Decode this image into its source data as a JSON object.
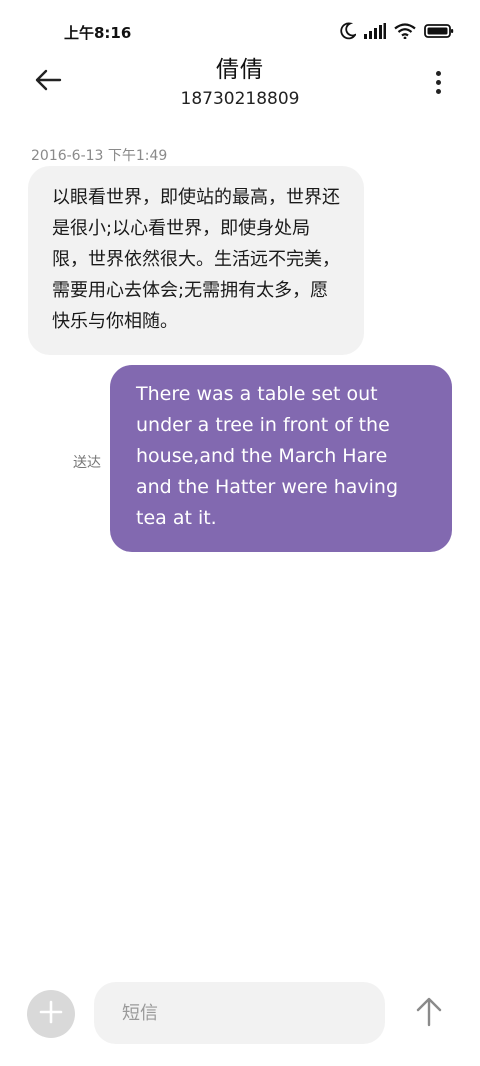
{
  "status_bar": {
    "time": "上午8:16",
    "icons": [
      "moon-icon",
      "signal-icon",
      "wifi-icon",
      "battery-icon"
    ]
  },
  "header": {
    "contact_name": "倩倩",
    "contact_number": "18730218809",
    "back_icon": "arrow-left-icon",
    "more_icon": "more-vertical-icon"
  },
  "conversation": {
    "timestamp": "2016-6-13 下午1:49",
    "incoming_message": "以眼看世界，即使站的最高，世界还是很小;以心看世界，即使身处局限，世界依然很大。生活远不完美，需要用心去体会;无需拥有太多，愿快乐与你相随。",
    "outgoing_message": "There was a table set out under a tree in front of the house,and the March Hare and the Hatter were having tea at it.",
    "outgoing_status": "送达"
  },
  "composer": {
    "placeholder": "短信",
    "value": "",
    "add_icon": "plus-icon",
    "send_icon": "arrow-up-icon"
  },
  "colors": {
    "outgoing_bubble": "#8269b0",
    "incoming_bubble": "#f2f2f2",
    "input_background": "#f2f2f2",
    "add_button": "#d9d9d9"
  }
}
